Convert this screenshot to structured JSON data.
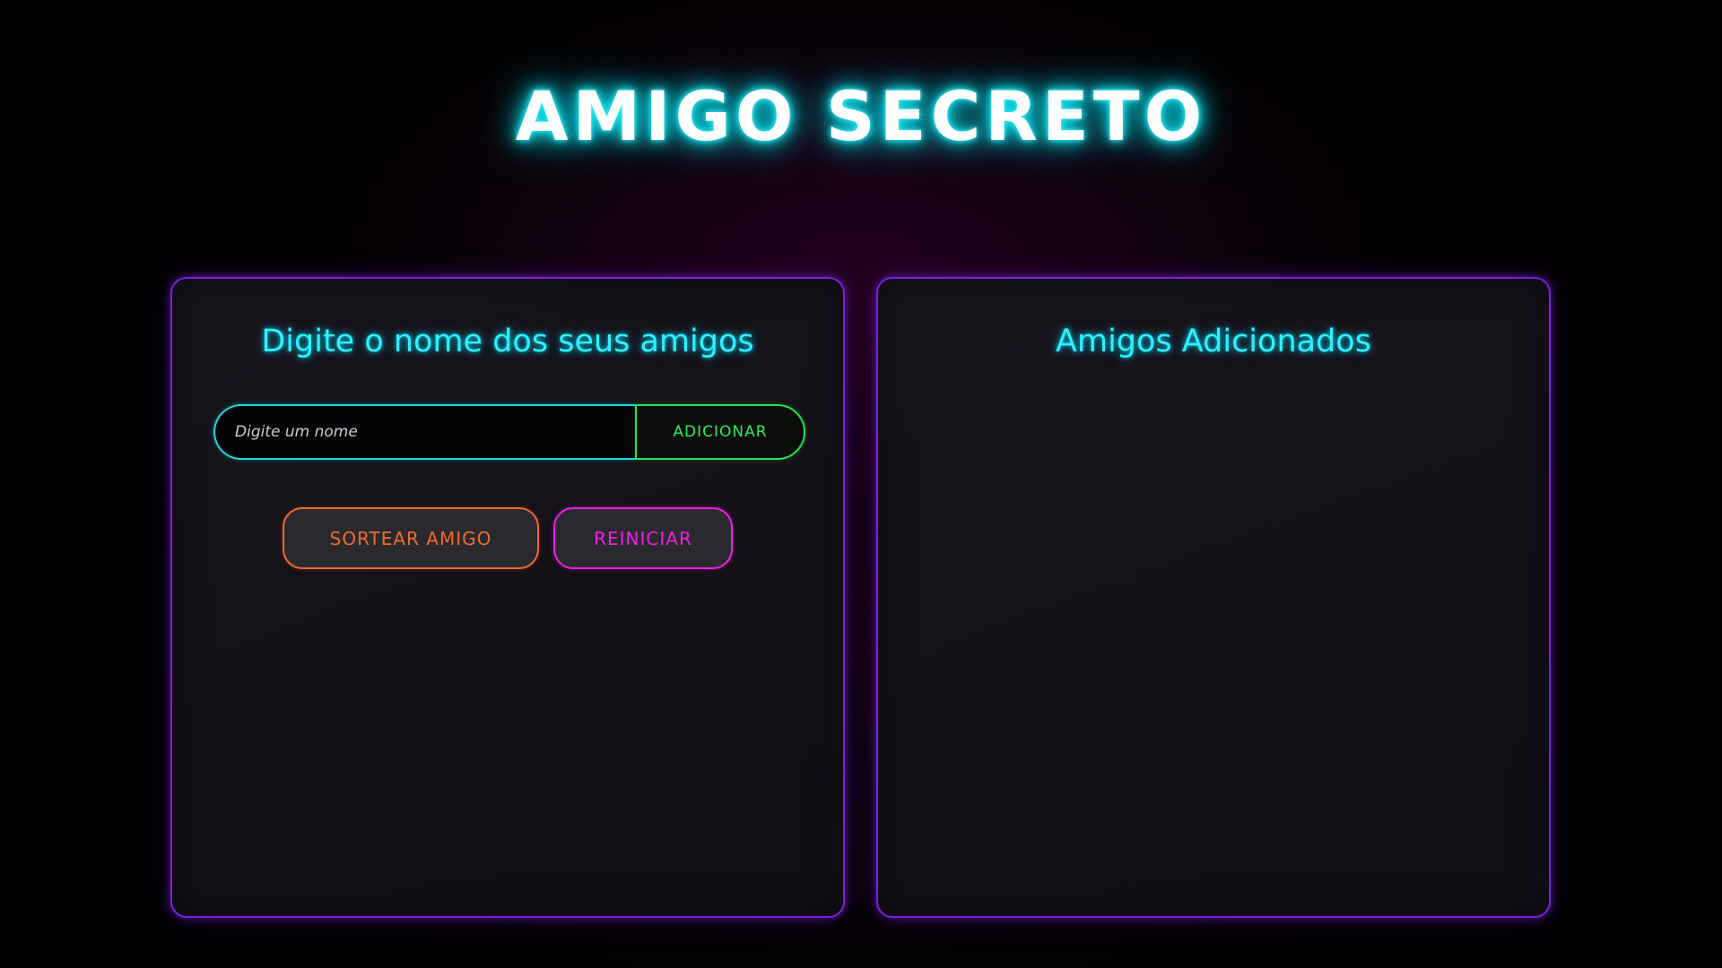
{
  "header": {
    "title": "AMIGO SECRETO"
  },
  "input_panel": {
    "heading": "Digite o nome dos seus amigos",
    "name_input": {
      "value": "",
      "placeholder": "Digite um nome"
    },
    "add_button_label": "Adicionar",
    "draw_button_label": "Sortear Amigo",
    "reset_button_label": "Reiniciar"
  },
  "friends_panel": {
    "heading": "Amigos Adicionados",
    "friends": []
  },
  "colors": {
    "title_glow": "#00dbe8",
    "heading": "#2ff0ff",
    "panel_border": "#7a1ee6",
    "input_border": "#19dbe0",
    "add_button": "#27e04f",
    "draw_button": "#f0682a",
    "reset_button": "#f01ee6",
    "background": "#000000"
  }
}
